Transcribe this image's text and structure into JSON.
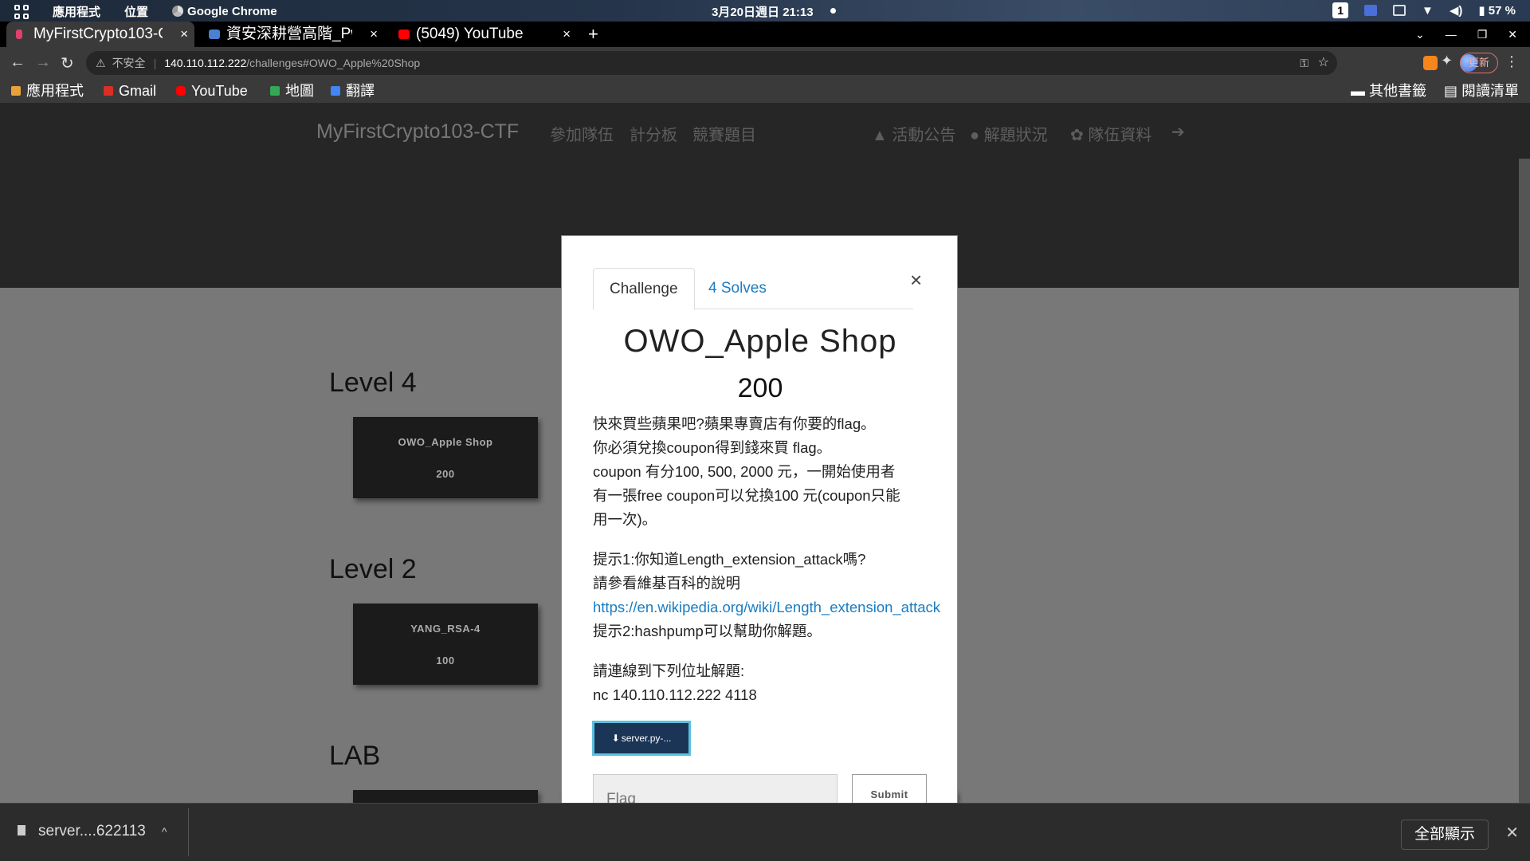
{
  "os": {
    "apps_label": "應用程式",
    "places_label": "位置",
    "active_app": "Google Chrome",
    "clock": "3月20日週日 21:13",
    "workspace": "1",
    "battery": "57 %"
  },
  "tabs": [
    {
      "label": "MyFirstCrypto103-C",
      "color": "#e0416a"
    },
    {
      "label": "資安深耕營高階_Pw",
      "color": "#4a7fd1"
    },
    {
      "label": "(5049) YouTube",
      "color": "#ff0000"
    }
  ],
  "omnibox": {
    "insecure": "不安全",
    "host": "140.110.112.222",
    "path": "/challenges#OWO_Apple%20Shop",
    "update_label": "更新"
  },
  "bookmarks": {
    "items": [
      {
        "label": "應用程式",
        "color": "#e9a23b"
      },
      {
        "label": "Gmail",
        "color": "#d93025"
      },
      {
        "label": "YouTube",
        "color": "#ff0000"
      },
      {
        "label": "地圖",
        "color": "#34a853"
      },
      {
        "label": "翻譯",
        "color": "#4285f4"
      }
    ],
    "other": "其他書籤",
    "reading_list": "閱讀清單"
  },
  "site": {
    "brand": "MyFirstCrypto103-CTF",
    "nav": [
      "參加隊伍",
      "計分板",
      "競賽題目",
      "活動公告",
      "解題狀況",
      "隊伍資料"
    ]
  },
  "levels": [
    {
      "title": "Level 4",
      "cards": [
        {
          "name": "OWO_Apple Shop",
          "points": "200"
        }
      ]
    },
    {
      "title": "Level 2",
      "cards": [
        {
          "name": "YANG_RSA-4",
          "points": "100"
        }
      ]
    },
    {
      "title": "LAB",
      "cards": []
    }
  ],
  "modal": {
    "tab_challenge": "Challenge",
    "tab_solves": "4 Solves",
    "title": "OWO_Apple Shop",
    "value": "200",
    "desc_lines": [
      "快來買些蘋果吧?蘋果專賣店有你要的flag。",
      "你必須兌換coupon得到錢來買 flag。",
      "coupon 有分100, 500, 2000 元，一開始使用者",
      "有一張free coupon可以兌換100 元(coupon只能",
      "用一次)。"
    ],
    "hint1": "提示1:你知道Length_extension_attack嗎?",
    "hint1_wiki": "請參看維基百科的說明",
    "hint1_link": "https://en.wikipedia.org/wiki/Length_extension_attack",
    "hint2": "提示2:hashpump可以幫助你解題。",
    "connect_label": "請連線到下列位址解題:",
    "connect_cmd": "nc 140.110.112.222 4118",
    "file_button": "server.py-...",
    "flag_placeholder": "Flag",
    "submit_label": "Submit"
  },
  "download_bar": {
    "file": "server....622113",
    "show_all": "全部顯示"
  }
}
